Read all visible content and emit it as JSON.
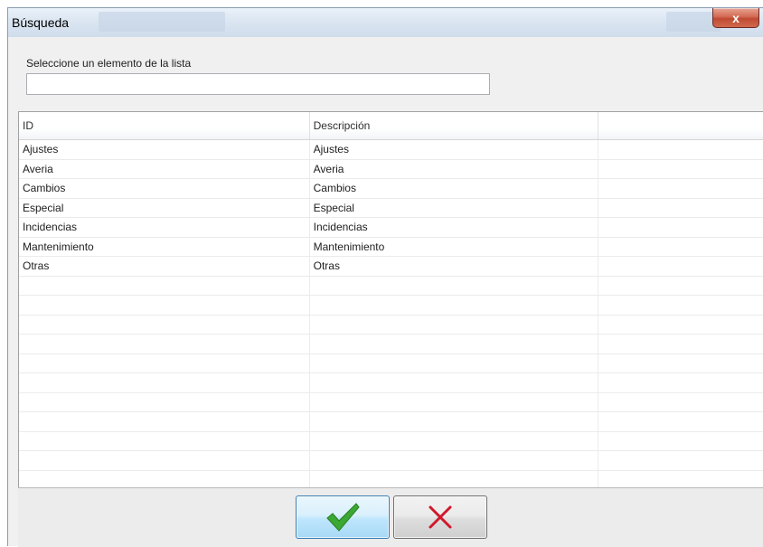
{
  "window": {
    "title": "Búsqueda",
    "close_glyph": "x"
  },
  "prompt": {
    "label": "Seleccione un elemento de la lista",
    "filter_value": "",
    "filter_placeholder": ""
  },
  "grid": {
    "columns": [
      "ID",
      "Descripción",
      ""
    ],
    "rows": [
      [
        "Ajustes",
        "Ajustes",
        ""
      ],
      [
        "Averia",
        "Averia",
        ""
      ],
      [
        "Cambios",
        "Cambios",
        ""
      ],
      [
        "Especial",
        "Especial",
        ""
      ],
      [
        "Incidencias",
        "Incidencias",
        ""
      ],
      [
        "Mantenimiento",
        "Mantenimiento",
        ""
      ],
      [
        "Otras",
        "Otras",
        ""
      ]
    ],
    "empty_rows": 11
  },
  "actions": {
    "ok_icon": "checkmark-icon",
    "ok_color": "#3aa832",
    "cancel_icon": "cross-icon",
    "cancel_color": "#d0182c"
  }
}
